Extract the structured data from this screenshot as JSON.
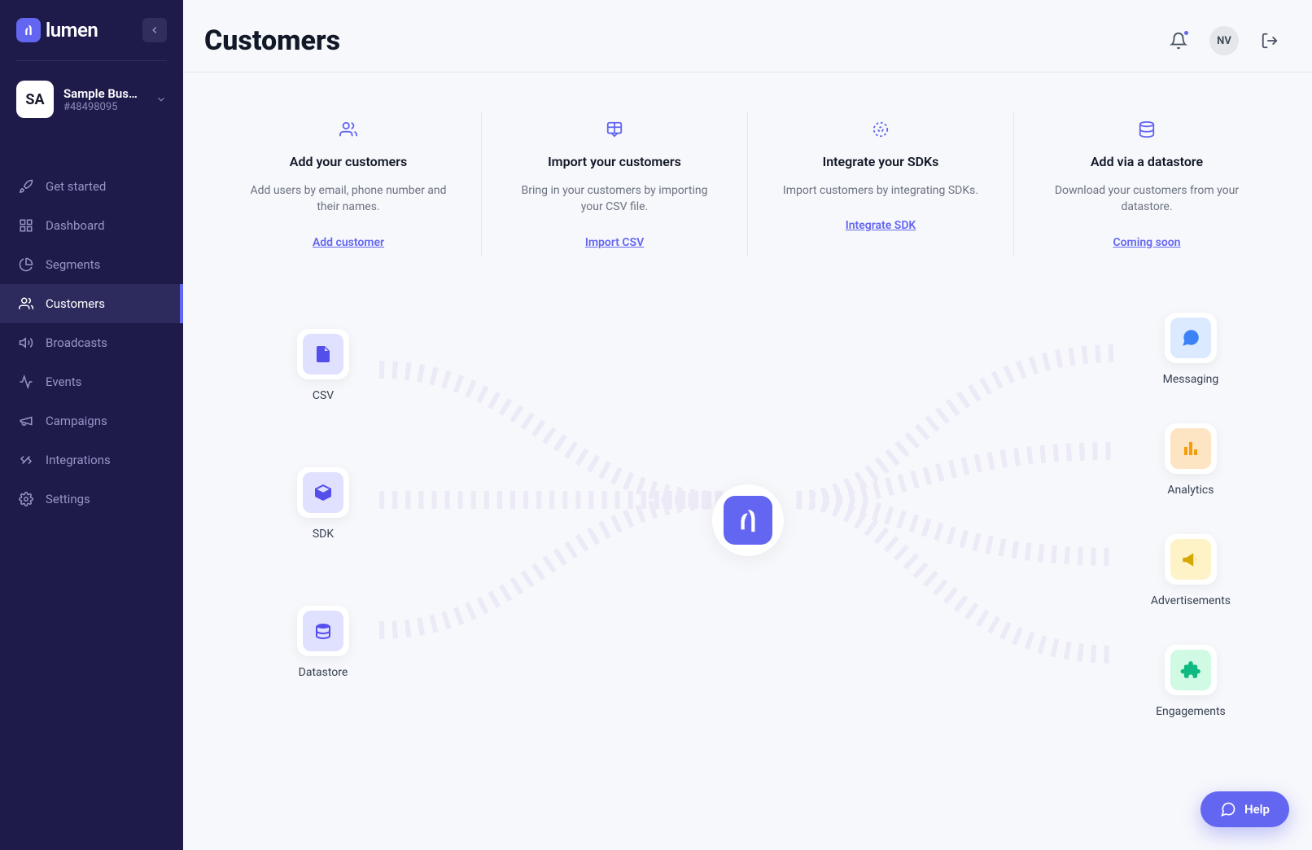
{
  "app": {
    "name": "lumen",
    "logo_abbrev": "✋"
  },
  "business": {
    "abbrev": "SA",
    "name": "Sample Bus…",
    "id": "#48498095"
  },
  "sidebar": {
    "items": [
      {
        "label": "Get started",
        "name": "get-started",
        "icon": "rocket"
      },
      {
        "label": "Dashboard",
        "name": "dashboard",
        "icon": "grid"
      },
      {
        "label": "Segments",
        "name": "segments",
        "icon": "pie"
      },
      {
        "label": "Customers",
        "name": "customers",
        "icon": "users",
        "active": true
      },
      {
        "label": "Broadcasts",
        "name": "broadcasts",
        "icon": "megaphone"
      },
      {
        "label": "Events",
        "name": "events",
        "icon": "activity"
      },
      {
        "label": "Campaigns",
        "name": "campaigns",
        "icon": "announce"
      },
      {
        "label": "Integrations",
        "name": "integrations",
        "icon": "plug"
      },
      {
        "label": "Settings",
        "name": "settings",
        "icon": "gear"
      }
    ]
  },
  "header": {
    "title": "Customers",
    "user_initials": "NV"
  },
  "cards": [
    {
      "title": "Add your customers",
      "desc": "Add users by email, phone number and their names.",
      "link": "Add customer",
      "icon": "users"
    },
    {
      "title": "Import your customers",
      "desc": "Bring in your customers by importing your CSV file.",
      "link": "Import CSV",
      "icon": "table-import"
    },
    {
      "title": "Integrate your SDKs",
      "desc": "Import customers by integrating SDKs.",
      "link": "Integrate SDK",
      "icon": "target"
    },
    {
      "title": "Add via a datastore",
      "desc": "Download your customers from your datastore.",
      "link": "Coming soon",
      "icon": "database"
    }
  ],
  "diagram": {
    "inputs": [
      {
        "label": "CSV",
        "icon": "file",
        "color": "purple"
      },
      {
        "label": "SDK",
        "icon": "cube",
        "color": "purple"
      },
      {
        "label": "Datastore",
        "icon": "stack",
        "color": "purple"
      }
    ],
    "outputs": [
      {
        "label": "Messaging",
        "icon": "chat",
        "color": "blue"
      },
      {
        "label": "Analytics",
        "icon": "bars",
        "color": "orange"
      },
      {
        "label": "Advertisements",
        "icon": "horn",
        "color": "yellow"
      },
      {
        "label": "Engagements",
        "icon": "puzzle",
        "color": "green"
      }
    ]
  },
  "help": {
    "label": "Help"
  },
  "colors": {
    "accent": "#6366f1",
    "sidebar_bg": "#1e1b4b"
  }
}
